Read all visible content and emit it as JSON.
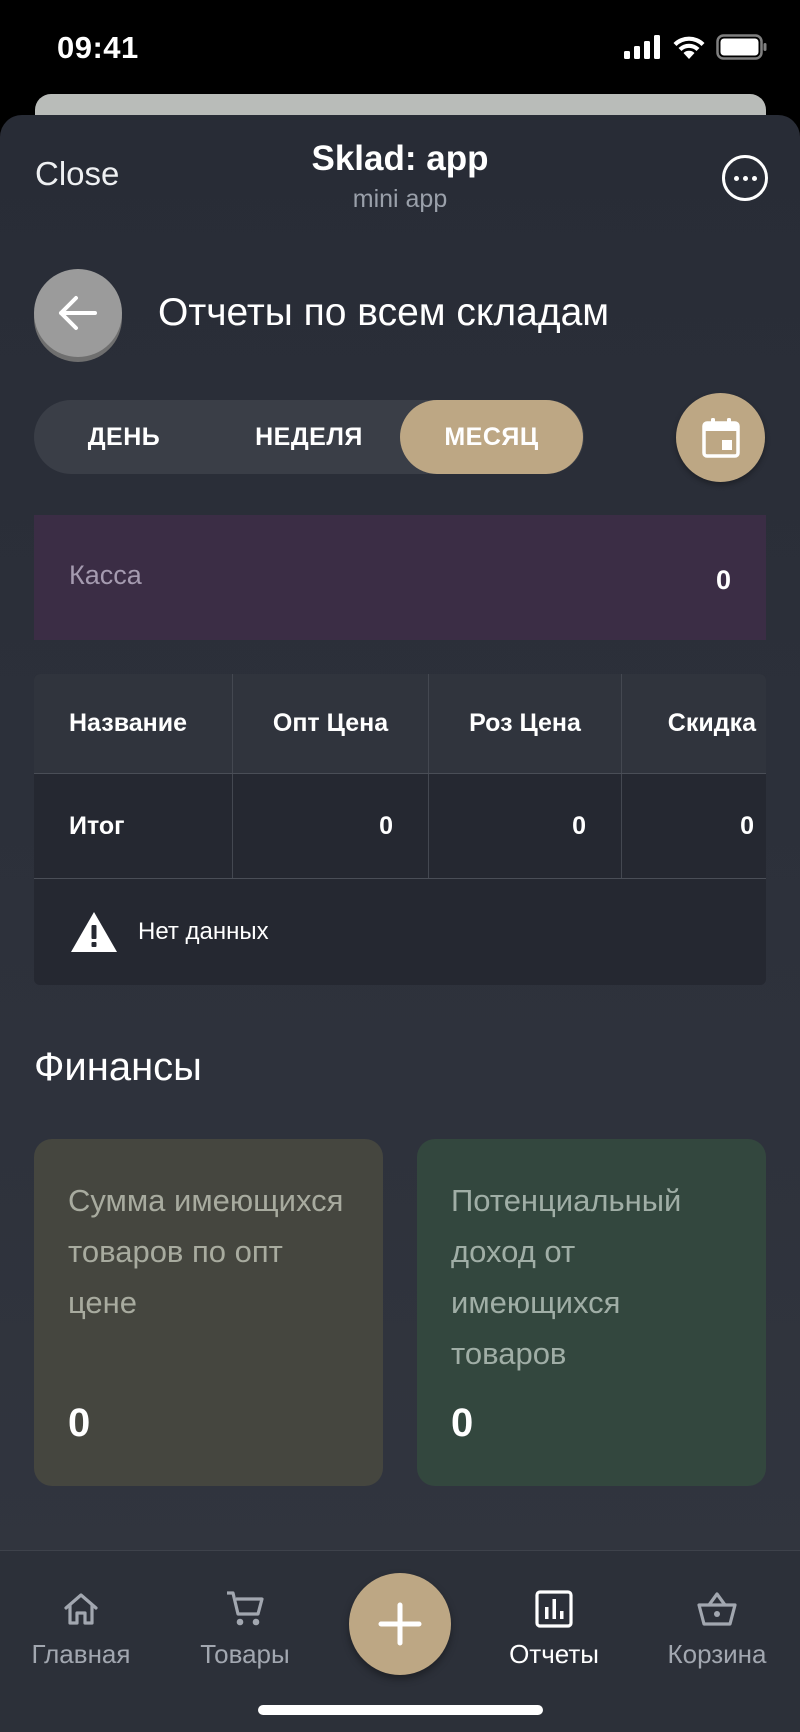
{
  "status_bar": {
    "time": "09:41"
  },
  "mini_app": {
    "close_label": "Close",
    "title": "Sklad: app",
    "subtitle": "mini app"
  },
  "page": {
    "title": "Отчеты по всем складам"
  },
  "period_tabs": [
    {
      "label": "ДЕНЬ",
      "active": false
    },
    {
      "label": "НЕДЕЛЯ",
      "active": false
    },
    {
      "label": "МЕСЯЦ",
      "active": true
    }
  ],
  "kassa": {
    "label": "Касса",
    "value": "0"
  },
  "table": {
    "columns": [
      "Название",
      "Опт Цена",
      "Роз Цена",
      "Скидка"
    ],
    "total_row": [
      "Итог",
      "0",
      "0",
      "0"
    ],
    "empty_text": "Нет данных"
  },
  "finance": {
    "title": "Финансы",
    "cards": [
      {
        "label": "Сумма имеющихся товаров по опт цене",
        "value": "0"
      },
      {
        "label": "Потенциальный доход от имеющихся товаров",
        "value": "0"
      }
    ]
  },
  "bottom_nav": [
    {
      "label": "Главная",
      "icon": "home-icon",
      "active": false
    },
    {
      "label": "Товары",
      "icon": "cart-icon",
      "active": false
    },
    {
      "label": "Отчеты",
      "icon": "bar-chart-icon",
      "active": true
    },
    {
      "label": "Корзина",
      "icon": "basket-icon",
      "active": false
    }
  ],
  "colors": {
    "accent": "#bda784",
    "background": "#2c3039",
    "kassa_bg": "#3b2d45",
    "finance_card_1": "#45463f",
    "finance_card_2": "#33473e"
  }
}
